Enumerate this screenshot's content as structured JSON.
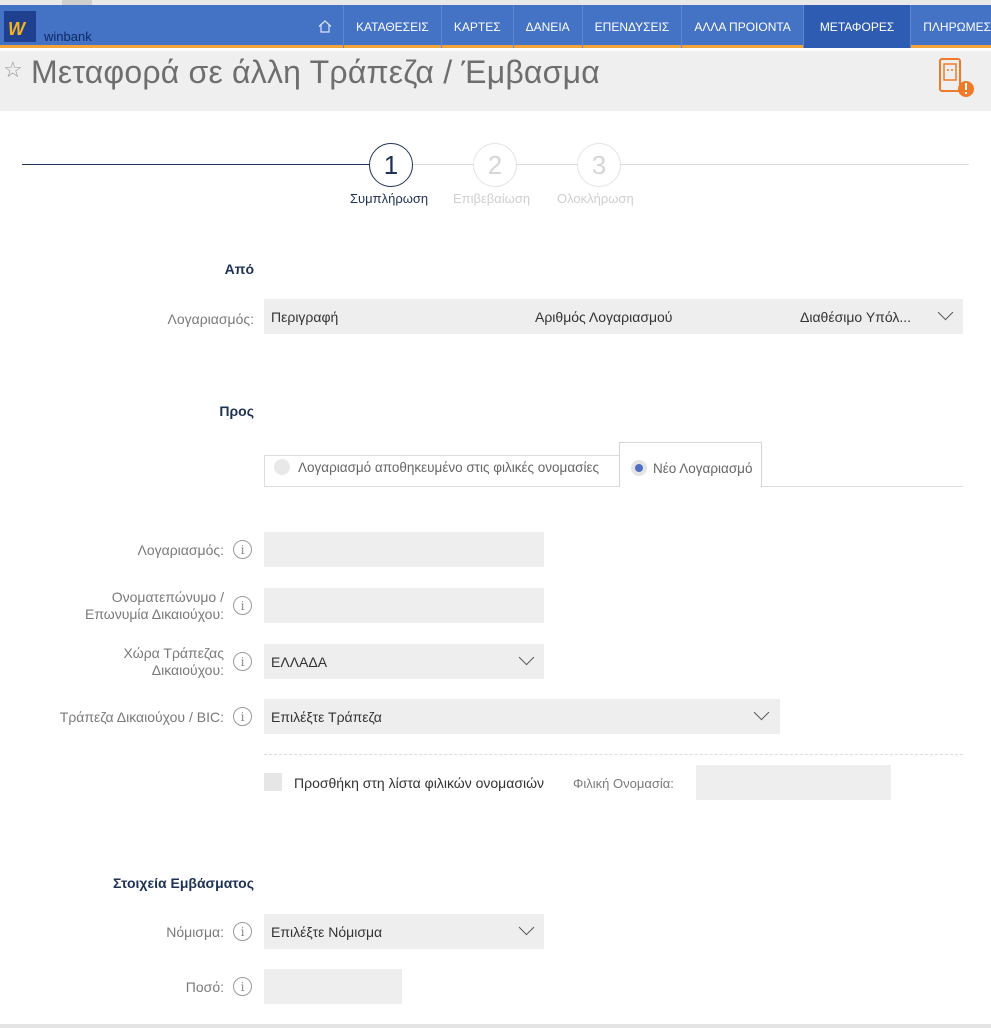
{
  "header": {
    "brand": "winbank",
    "logo_mark": "W",
    "home_icon": "home-icon",
    "menu": [
      "ΚΑΤΑΘΕΣΕΙΣ",
      "ΚΑΡΤΕΣ",
      "ΔΑΝΕΙΑ",
      "ΕΠΕΝΔΥΣΕΙΣ",
      "ΑΛΛΑ ΠΡΟΙΟΝΤΑ",
      "ΜΕΤΑΦΟΡΕΣ",
      "ΠΛΗΡΩΜΕΣ"
    ],
    "active_item": "ΜΕΤΑΦΟΡΕΣ",
    "colors": {
      "nav": "#4472c4",
      "nav_active": "#2f5cb3",
      "accent": "#f2a33a"
    }
  },
  "page": {
    "title": "Μεταφορά σε άλλη Τράπεζα / Έμβασμα",
    "favorite_icon": "star-icon",
    "alert_icon": "mobile-alert-icon"
  },
  "steps": [
    {
      "number": "1",
      "label": "Συμπλήρωση",
      "state": "active"
    },
    {
      "number": "2",
      "label": "Επιβεβαίωση",
      "state": "inactive"
    },
    {
      "number": "3",
      "label": "Ολοκλήρωση",
      "state": "inactive"
    }
  ],
  "from": {
    "heading": "Από",
    "account_label": "Λογαριασμός:",
    "account_columns": [
      "Περιγραφή",
      "Αριθμός Λογαριασμού",
      "Διαθέσιμο Υπόλ..."
    ]
  },
  "to": {
    "heading": "Προς",
    "tabs": [
      {
        "label": "Λογαριασμό αποθηκευμένο στις φιλικές ονομασίες",
        "selected": false
      },
      {
        "label": "Νέο Λογαριασμό",
        "selected": true
      }
    ],
    "account_label": "Λογαριασμός:",
    "account_value": "",
    "beneficiary_label_1": "Ονοματεπώνυμο /",
    "beneficiary_label_2": "Επωνυμία Δικαιούχου:",
    "beneficiary_value": "",
    "country_label_1": "Χώρα Τράπεζας",
    "country_label_2": "Δικαιούχου:",
    "country_value": "ΕΛΛΑΔΑ",
    "bank_label": "Τράπεζα Δικαιούχου / BIC:",
    "bank_value": "Επιλέξτε Τράπεζα",
    "add_to_list_label": "Προσθήκη στη λίστα φιλικών ονομασιών",
    "add_to_list_checked": false,
    "nickname_label": "Φιλική Ονομασία:",
    "nickname_value": ""
  },
  "remittance": {
    "heading": "Στοιχεία Εμβάσματος",
    "currency_label": "Νόμισμα:",
    "currency_value": "Επιλέξτε Νόμισμα",
    "amount_label": "Ποσό:",
    "amount_value": ""
  },
  "info_glyph": "i"
}
